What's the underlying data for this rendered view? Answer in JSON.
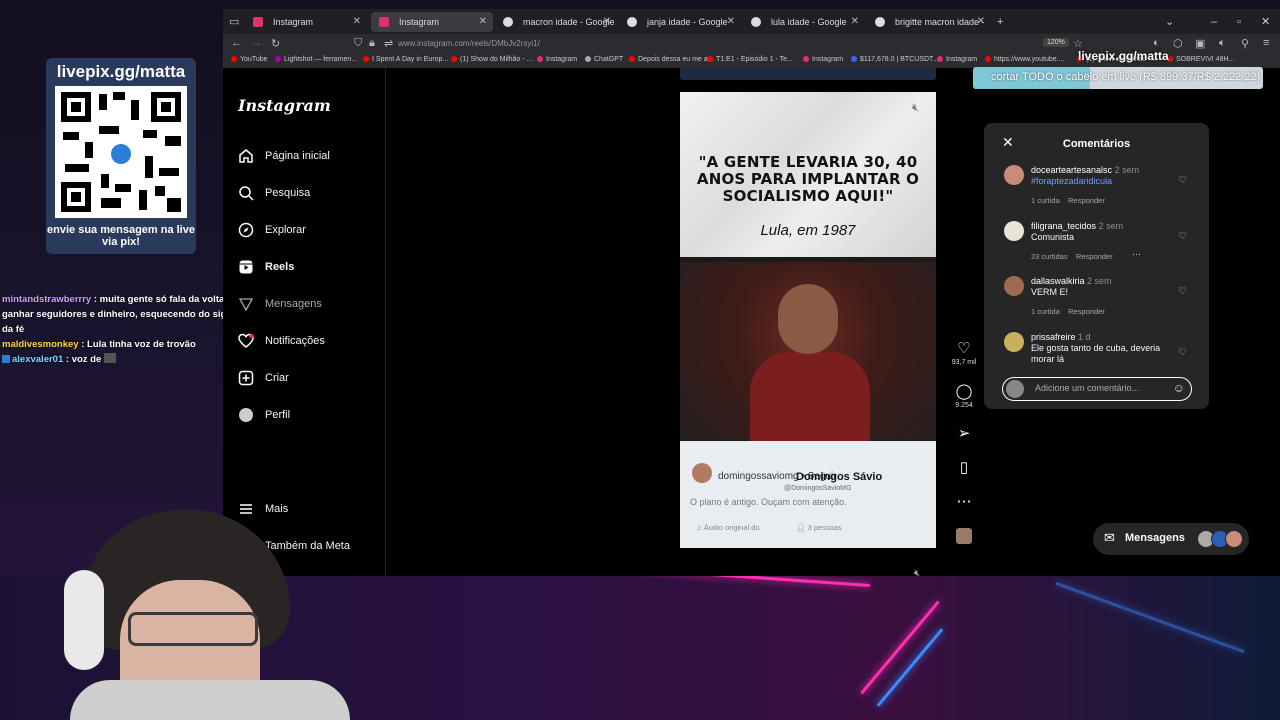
{
  "overlay": {
    "qr_title": "livepix.gg/matta",
    "qr_footer": "envie sua mensagem na live via pix!",
    "banner_handle": "livepix.gg/matta",
    "goal_text": "cortar TODO o cabelo em live (R$ 899,37/R$ 2.222,22)",
    "goal_progress": 0.405
  },
  "chat": [
    {
      "user": "mintandstrawberrry",
      "message": ": muita gente só fala da volta de Jesus para ganhar seguidores e dinheiro, esquecendo do significado verdadeiro da fé"
    },
    {
      "user": "maldivesmonkey",
      "message": ": Lula tinha voz de trovão"
    },
    {
      "user": "alexvaler01",
      "message": ": voz de"
    }
  ],
  "browser": {
    "tabs": [
      {
        "title": "Instagram",
        "active": false
      },
      {
        "title": "Instagram",
        "active": true
      },
      {
        "title": "macron idade - Google Search",
        "active": false
      },
      {
        "title": "janja idade - Google Search",
        "active": false
      },
      {
        "title": "lula idade - Google Search",
        "active": false
      },
      {
        "title": "brigitte macron idade - Google",
        "active": false
      }
    ],
    "url": "www.instagram.com/reels/DMbJv2rsyi1/",
    "zoom": "120%",
    "bookmarks": [
      "YouTube",
      "Lightshot — ferramen...",
      "I Spent A Day in Europ...",
      "(1) Show do Milhão - ...",
      "Instagram",
      "ChatGPT",
      "Depois dessa eu me a...",
      "T1:E1 - Episódio 1 - Te...",
      "Instagram",
      "$117,678.0 | BTCUSDT...",
      "Instagram",
      "https://www.youtube....",
      "(1) Show do Milhão -...",
      "SOBREVIVI 48H..."
    ]
  },
  "instagram": {
    "logo": "Instagram",
    "nav": [
      {
        "label": "Página inicial",
        "icon": "home-icon"
      },
      {
        "label": "Pesquisa",
        "icon": "search-icon"
      },
      {
        "label": "Explorar",
        "icon": "compass-icon"
      },
      {
        "label": "Reels",
        "icon": "reels-icon"
      },
      {
        "label": "Mensagens",
        "icon": "messenger-icon"
      },
      {
        "label": "Notificações",
        "icon": "heart-icon"
      },
      {
        "label": "Criar",
        "icon": "plus-icon"
      },
      {
        "label": "Perfil",
        "icon": "profile-icon"
      }
    ],
    "more": "Mais",
    "meta": "Também da Meta",
    "reel": {
      "quote": "\"A GENTE LEVARIA 30, 40 ANOS PARA IMPLANTAR O SOCIALISMO AQUI!\"",
      "quote_sub": "Lula, em 1987",
      "author_line": "domingossaviomg • Seguir",
      "display_name": "Domingos Sávio",
      "handle": "@DomingosSavioMG",
      "caption": "O plano é antigo. Ouçam com atenção.",
      "audio": "Áudio original  do",
      "people": "3 pessoas"
    },
    "actions": {
      "likes": "93,7 mil",
      "comments": "9.254"
    },
    "comments": {
      "title": "Comentários",
      "input_placeholder": "Adicione um comentário...",
      "items": [
        {
          "user": "docearteartesanalsc",
          "time": "2 sem",
          "text": "#foraptezadaridicula",
          "likes": "1 curtida",
          "reply": "Responder"
        },
        {
          "user": "filigrana_tecidos",
          "time": "2 sem",
          "text": "Comunista",
          "likes": "23 curtidas",
          "reply": "Responder"
        },
        {
          "user": "dallaswalkiria",
          "time": "2 sem",
          "text": "VERM E!",
          "likes": "1 curtida",
          "reply": "Responder"
        },
        {
          "user": "prissafreire",
          "time": "1 d",
          "text": "Ele gosta tanto de cuba, deveria morar lá",
          "likes": "",
          "reply": ""
        }
      ]
    },
    "messages_label": "Mensagens"
  }
}
